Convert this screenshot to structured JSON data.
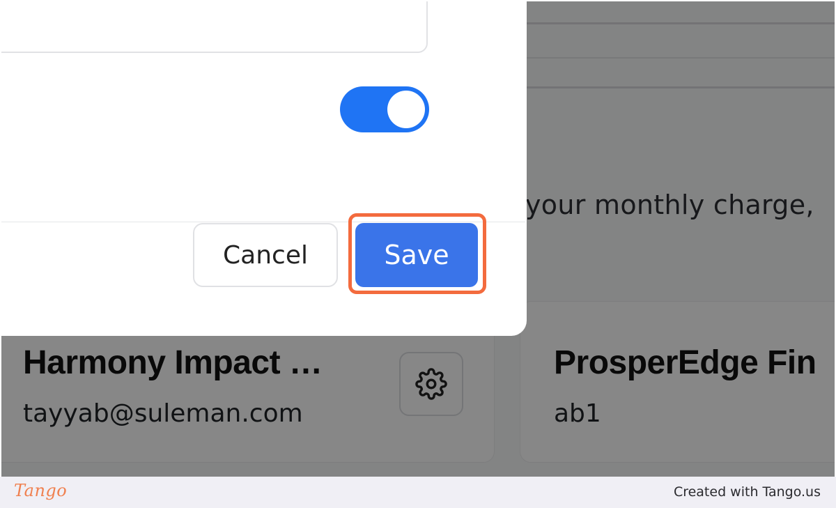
{
  "background": {
    "description_fragment": "your monthly charge,",
    "cards": [
      {
        "name": "Harmony Impact …",
        "email": "tayyab@suleman.com",
        "settings_icon": "gear-icon"
      },
      {
        "name": "ProsperEdge Fin",
        "email": "ab1"
      }
    ]
  },
  "modal": {
    "toggle": {
      "state": "on"
    },
    "buttons": {
      "cancel": "Cancel",
      "save": "Save"
    }
  },
  "footer": {
    "logo": "Tango",
    "credit": "Created with Tango.us"
  },
  "colors": {
    "accent": "#3a74e9",
    "toggle_on": "#1f74f4",
    "highlight": "#f36b3e"
  }
}
